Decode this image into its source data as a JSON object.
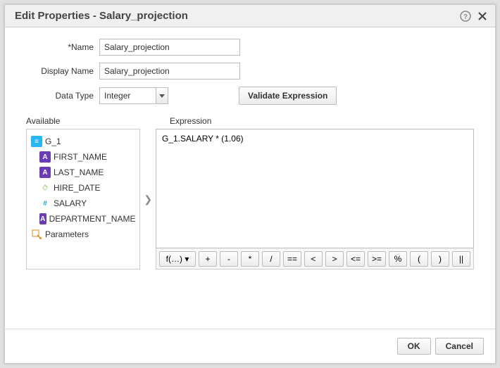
{
  "title": "Edit Properties - Salary_projection",
  "form": {
    "name_label": "Name",
    "name_value": "Salary_projection",
    "display_name_label": "Display Name",
    "display_name_value": "Salary_projection",
    "data_type_label": "Data Type",
    "data_type_value": "Integer",
    "validate_label": "Validate Expression"
  },
  "sections": {
    "available_label": "Available",
    "expression_label": "Expression"
  },
  "tree": {
    "root": "G_1",
    "children": [
      {
        "label": "FIRST_NAME",
        "type": "text"
      },
      {
        "label": "LAST_NAME",
        "type": "text"
      },
      {
        "label": "HIRE_DATE",
        "type": "date"
      },
      {
        "label": "SALARY",
        "type": "number"
      },
      {
        "label": "DEPARTMENT_NAME",
        "type": "text"
      }
    ],
    "parameters_label": "Parameters"
  },
  "expression_value": "G_1.SALARY * (1.06)",
  "move_icon": "❯",
  "operators": {
    "fn": "f(…) ▾",
    "ops": [
      "+",
      "-",
      "*",
      "/",
      "==",
      "<",
      ">",
      "<=",
      ">=",
      "%",
      "(",
      ")",
      "||"
    ]
  },
  "footer": {
    "ok": "OK",
    "cancel": "Cancel"
  }
}
